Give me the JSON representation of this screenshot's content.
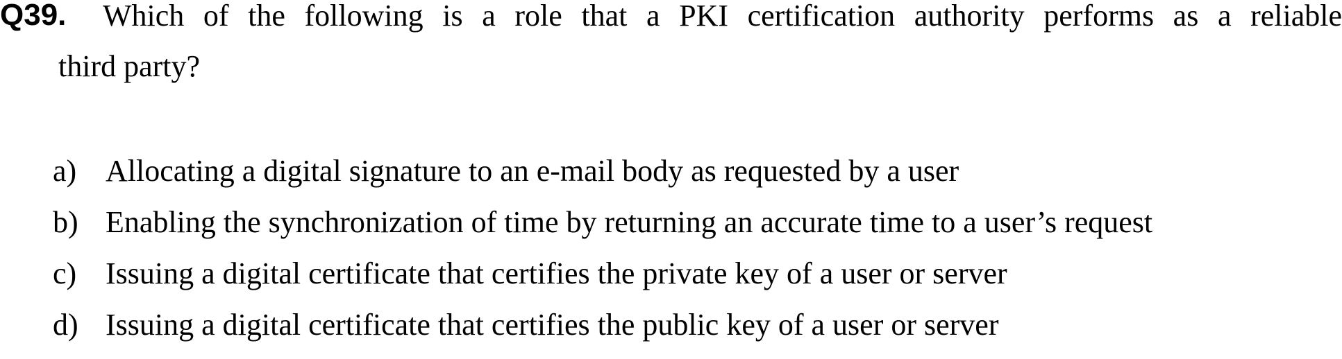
{
  "question": {
    "number": "Q39.",
    "text_line1": "Which of the following is a role that a PKI certification authority performs as a reliable",
    "text_line2": "third party?"
  },
  "options": [
    {
      "letter": "a)",
      "text": "Allocating a digital signature to an e-mail body as requested by a user"
    },
    {
      "letter": "b)",
      "text": "Enabling the synchronization of time by returning an accurate time to a user’s request"
    },
    {
      "letter": "c)",
      "text": "Issuing a digital certificate that certifies the private key of a user or server"
    },
    {
      "letter": "d)",
      "text": "Issuing a digital certificate that certifies the public key of a user or server"
    }
  ]
}
